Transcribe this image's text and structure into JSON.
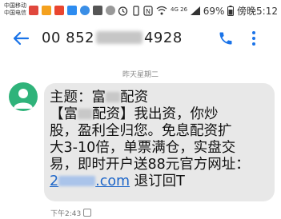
{
  "status_bar": {
    "carrier_1": "中国移动",
    "carrier_2": "中国电信",
    "battery": "69%",
    "app": "傍晚",
    "time": "5:12",
    "signal": "4G 26"
  },
  "header": {
    "number_prefix": "00 852",
    "number_suffix": "4928",
    "call_icon": "phone-icon",
    "menu_icon": "more-vert-icon",
    "back_icon": "arrow-back-icon"
  },
  "thread": {
    "date_separator": "昨天星期二",
    "message": {
      "subject_prefix": "主题：富",
      "subject_suffix": "配资",
      "line1_prefix": "【富",
      "line1_suffix": "配资】我出资，你炒",
      "line2": "股，盈利全归您。免息配资扩",
      "line3": "大3-10倍，单票满仓，实盘交",
      "line4": "易，即时开户送88元官方网址：",
      "link_prefix": "2",
      "link_suffix": ".com",
      "line5_tail": " 退订回T",
      "timestamp": "下午2:43"
    }
  },
  "colors": {
    "accent": "#1a73e8",
    "bubble": "#e8e8e8",
    "avatar": "#2fb37a"
  }
}
